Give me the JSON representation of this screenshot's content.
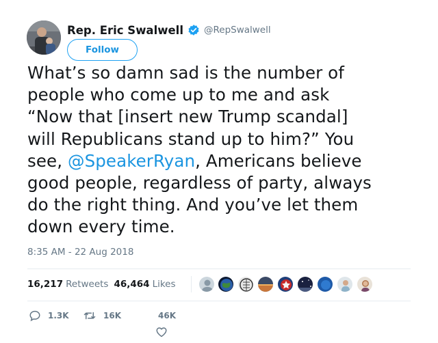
{
  "author": {
    "name": "Rep. Eric Swalwell",
    "handle": "@RepSwalwell",
    "avatar_icon": "profile-photo",
    "verified_icon": "verified-badge-icon"
  },
  "follow_label": "Follow",
  "tweet": {
    "lines": [
      "What’s so damn sad is the number of",
      "people who come up to me and ask",
      "“Now that [insert new Trump scandal]",
      "will Republicans stand up to him?” You"
    ],
    "line5_prefix": "see, ",
    "mention": "@SpeakerRyan",
    "line5_suffix": ", Americans believe",
    "lines_after": [
      "good people, regardless of party, always",
      "do the right thing. And you’ve let them",
      "down every time."
    ]
  },
  "timestamp": "8:35 AM - 22 Aug 2018",
  "stats": {
    "retweets_count": "16,217",
    "retweets_label": "Retweets",
    "likes_count": "46,464",
    "likes_label": "Likes"
  },
  "actions": {
    "reply_count": "1.3K",
    "retweet_count": "16K",
    "like_count": "46K"
  },
  "colors": {
    "link": "#1b95e0",
    "text": "#14171a",
    "muted": "#657786",
    "divider": "#e6ecf0",
    "verified": "#1da1f2"
  }
}
